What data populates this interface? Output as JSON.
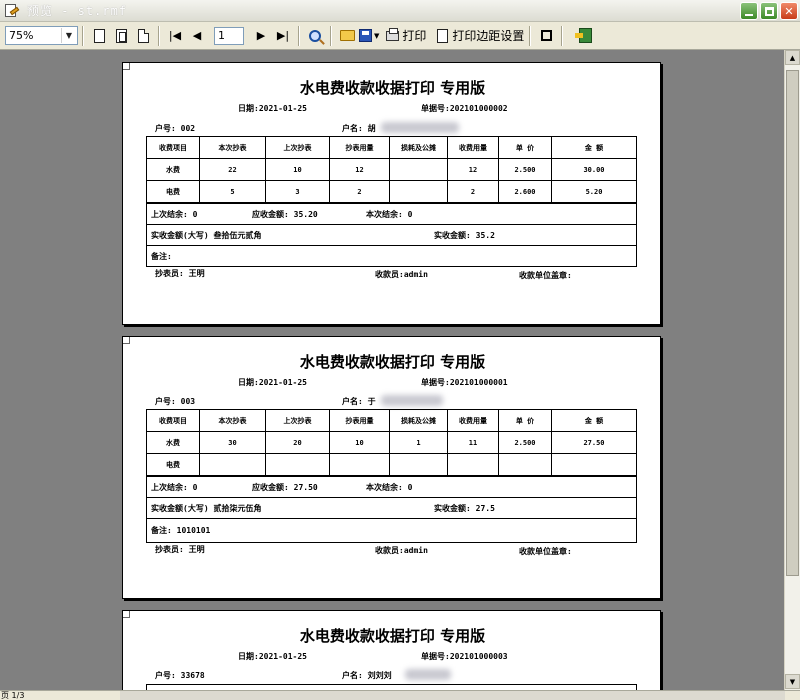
{
  "window": {
    "title": "预览 - st.rmf"
  },
  "toolbar": {
    "zoom": "75%",
    "page_number": "1",
    "print_label": "打印",
    "margin_label": "打印边距设置"
  },
  "report": {
    "title": "水电费收款收据打印 专用版",
    "date": "日期:2021-01-25",
    "headers": [
      "收费项目",
      "本次抄表",
      "上次抄表",
      "抄表用量",
      "损耗及公摊",
      "收费用量",
      "单 价",
      "金 额"
    ],
    "labels": {
      "household": "户号:",
      "name": "户名:",
      "prev_balance": "上次结余:",
      "amount_due": "应收金额:",
      "this_balance": "本次结余:",
      "paid_upper": "实收金额(大写)",
      "paid": "实收金额:",
      "remark": "备注:",
      "reader": "抄表员:",
      "collector": "收款员:",
      "signature": "收款单位盖章:"
    }
  },
  "receipts": [
    {
      "household_no": "户号: 002",
      "name_visible": "户名: 胡",
      "receipt_no": "单据号:202101000002",
      "rows": [
        {
          "item": "水费",
          "current": "22",
          "previous": "10",
          "usage": "12",
          "loss": "",
          "charge_usage": "12",
          "price": "2.500",
          "amount": "30.00"
        },
        {
          "item": "电费",
          "current": "5",
          "previous": "3",
          "usage": "2",
          "loss": "",
          "charge_usage": "2",
          "price": "2.600",
          "amount": "5.20"
        }
      ],
      "prev_balance": "上次结余: 0",
      "amount_due": "应收金额:  35.20",
      "this_balance": "本次结余:  0",
      "paid_upper": "实收金额(大写)  叁拾伍元贰角",
      "paid": "实收金额:   35.2",
      "remark": "备注:",
      "reader": "抄表员: 王明",
      "collector": "收款员:admin",
      "signature": "收款单位盖章:"
    },
    {
      "household_no": "户号: 003",
      "name_visible": "户名: 于",
      "receipt_no": "单据号:202101000001",
      "rows": [
        {
          "item": "水费",
          "current": "30",
          "previous": "20",
          "usage": "10",
          "loss": "1",
          "charge_usage": "11",
          "price": "2.500",
          "amount": "27.50"
        },
        {
          "item": "电费",
          "current": "",
          "previous": "",
          "usage": "",
          "loss": "",
          "charge_usage": "",
          "price": "",
          "amount": ""
        }
      ],
      "prev_balance": "上次结余: 0",
      "amount_due": "应收金额:  27.50",
      "this_balance": "本次结余:  0",
      "paid_upper": "实收金额(大写)  贰拾柒元伍角",
      "paid": "实收金额:   27.5",
      "remark": "备注: 1010101",
      "reader": "抄表员: 王明",
      "collector": "收款员:admin",
      "signature": "收款单位盖章:"
    },
    {
      "household_no": "户号: 33678",
      "name_visible": "户名: 刘刘刘",
      "receipt_no": "单据号:202101000003"
    }
  ],
  "status": {
    "page": "页 1/3"
  }
}
